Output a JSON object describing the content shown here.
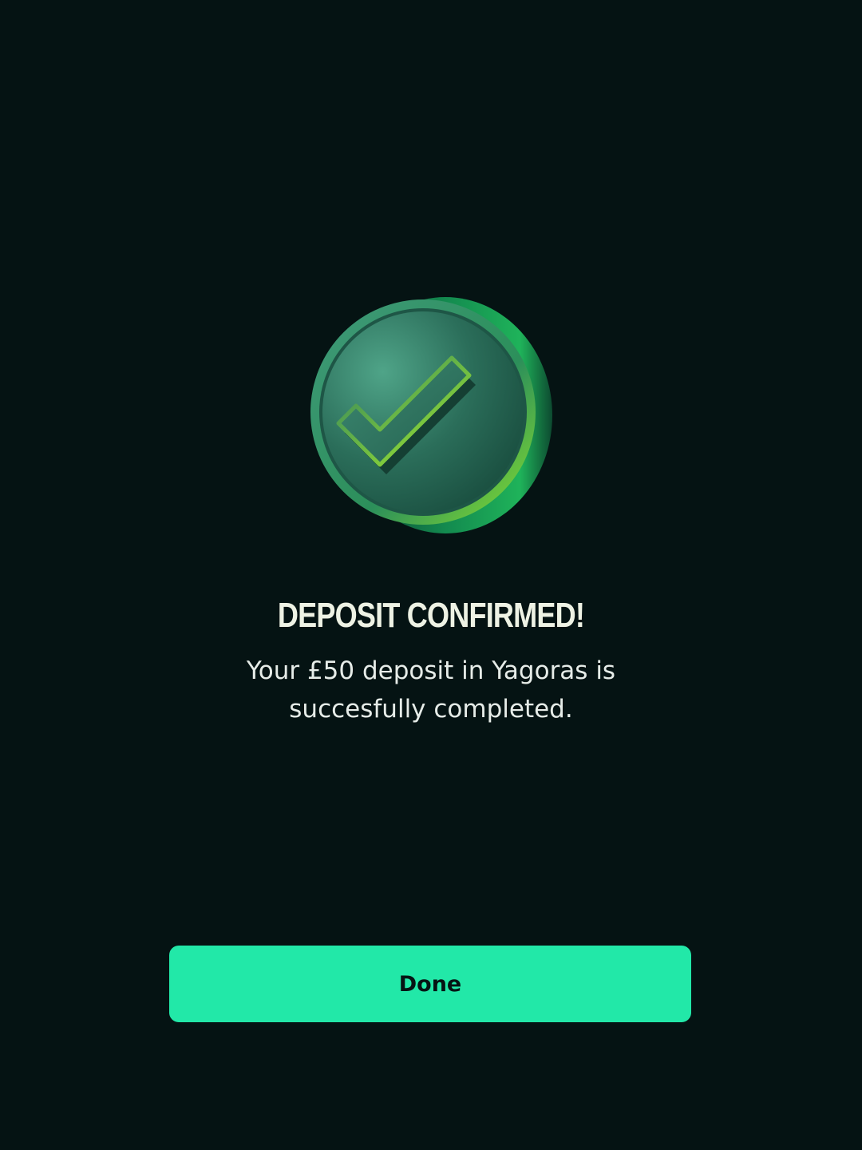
{
  "confirmation": {
    "title": "DEPOSIT CONFIRMED!",
    "message": "Your £50 deposit in Yagoras is succesfully completed.",
    "icon": "check-coin-icon"
  },
  "actions": {
    "done_label": "Done"
  },
  "colors": {
    "background": "#051313",
    "accent": "#22e8a8",
    "title_text": "#eef2e4",
    "body_text": "#e6ece8"
  }
}
